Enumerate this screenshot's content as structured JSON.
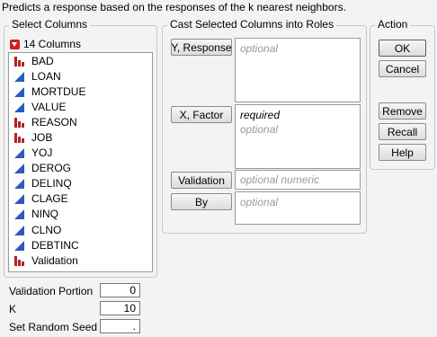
{
  "description": "Predicts a response based on the responses of the k nearest neighbors.",
  "select_columns": {
    "title": "Select Columns",
    "count_label": "14 Columns",
    "columns": [
      {
        "name": "BAD",
        "type": "nominal"
      },
      {
        "name": "LOAN",
        "type": "continuous"
      },
      {
        "name": "MORTDUE",
        "type": "continuous"
      },
      {
        "name": "VALUE",
        "type": "continuous"
      },
      {
        "name": "REASON",
        "type": "nominal"
      },
      {
        "name": "JOB",
        "type": "nominal"
      },
      {
        "name": "YOJ",
        "type": "continuous"
      },
      {
        "name": "DEROG",
        "type": "continuous"
      },
      {
        "name": "DELINQ",
        "type": "continuous"
      },
      {
        "name": "CLAGE",
        "type": "continuous"
      },
      {
        "name": "NINQ",
        "type": "continuous"
      },
      {
        "name": "CLNO",
        "type": "continuous"
      },
      {
        "name": "DEBTINC",
        "type": "continuous"
      },
      {
        "name": "Validation",
        "type": "nominal"
      }
    ]
  },
  "cast_roles": {
    "title": "Cast Selected Columns into Roles",
    "y_response": {
      "label": "Y, Response",
      "placeholder": "optional"
    },
    "x_factor": {
      "label": "X, Factor",
      "required": "required",
      "placeholder": "optional"
    },
    "validation": {
      "label": "Validation",
      "placeholder": "optional numeric"
    },
    "by": {
      "label": "By",
      "placeholder": "optional"
    }
  },
  "action": {
    "title": "Action",
    "ok": "OK",
    "cancel": "Cancel",
    "remove": "Remove",
    "recall": "Recall",
    "help": "Help"
  },
  "params": {
    "validation_portion": {
      "label": "Validation Portion",
      "value": "0"
    },
    "k": {
      "label": "K",
      "value": "10"
    },
    "random_seed": {
      "label": "Set Random Seed",
      "value": "."
    }
  },
  "colors": {
    "nominal_icon": "#b22222",
    "continuous_icon": "#2a5bbf"
  }
}
